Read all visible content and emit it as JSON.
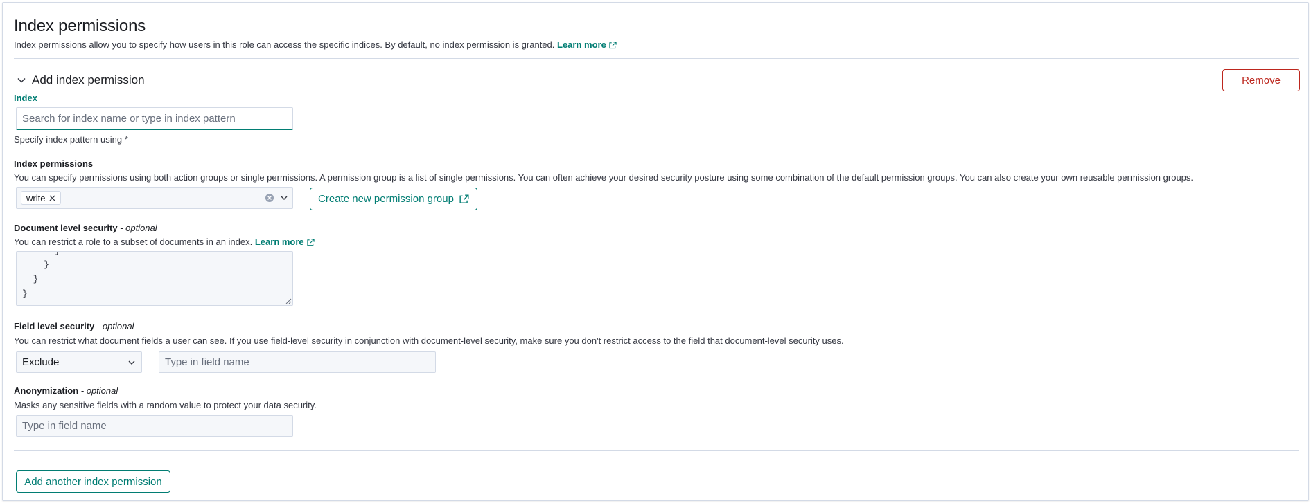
{
  "section": {
    "title": "Index permissions",
    "description": "Index permissions allow you to specify how users in this role can access the specific indices. By default, no index permission is granted.",
    "learn_more": "Learn more"
  },
  "accordion": {
    "title": "Add index permission",
    "remove_label": "Remove"
  },
  "index": {
    "label": "Index",
    "placeholder": "Search for index name or type in index pattern",
    "help": "Specify index pattern using *"
  },
  "index_permissions": {
    "label": "Index permissions",
    "description": "You can specify permissions using both action groups or single permissions. A permission group is a list of single permissions. You can often achieve your desired security posture using some combination of the default permission groups. You can also create your own reusable permission groups.",
    "selected": [
      "write"
    ],
    "create_button": "Create new permission group"
  },
  "dls": {
    "label": "Document level security",
    "optional": " - optional",
    "description": "You can restrict a role to a subset of documents in an index.",
    "learn_more": "Learn more",
    "code_lines": [
      "      }",
      "    }",
      "  }",
      "}"
    ]
  },
  "fls": {
    "label": "Field level security",
    "optional": " - optional",
    "description": "You can restrict what document fields a user can see. If you use field-level security in conjunction with document-level security, make sure you don't restrict access to the field that document-level security uses.",
    "mode": "Exclude",
    "placeholder": "Type in field name"
  },
  "anonymization": {
    "label": "Anonymization",
    "optional": " - optional",
    "description": "Masks any sensitive fields with a random value to protect your data security.",
    "placeholder": "Type in field name"
  },
  "footer": {
    "add_label": "Add another index permission"
  },
  "colors": {
    "accent": "#017d73",
    "danger": "#bd271e",
    "border": "#d3dae6",
    "input_bg": "#f5f7fa"
  }
}
